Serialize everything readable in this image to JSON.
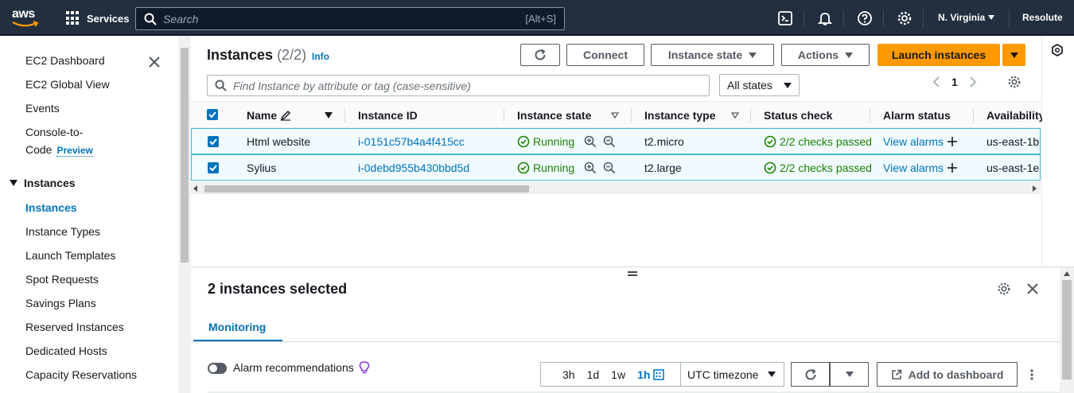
{
  "topnav": {
    "logo_text": "aws",
    "services_label": "Services",
    "search_placeholder": "Search",
    "search_shortcut": "[Alt+S]",
    "region_label": "N. Virginia",
    "account_label": "Resolute"
  },
  "sidebar": {
    "items": [
      {
        "label": "EC2 Dashboard"
      },
      {
        "label": "EC2 Global View"
      },
      {
        "label": "Events"
      },
      {
        "label": "Console-to-"
      },
      {
        "label": "Code"
      }
    ],
    "preview_badge": "Preview",
    "section_instances": "Instances",
    "instances_items": [
      {
        "label": "Instances",
        "active": true
      },
      {
        "label": "Instance Types"
      },
      {
        "label": "Launch Templates"
      },
      {
        "label": "Spot Requests"
      },
      {
        "label": "Savings Plans"
      },
      {
        "label": "Reserved Instances"
      },
      {
        "label": "Dedicated Hosts"
      },
      {
        "label": "Capacity Reservations"
      }
    ]
  },
  "main": {
    "title": "Instances",
    "count": "(2/2)",
    "info_label": "Info",
    "connect_label": "Connect",
    "instance_state_label": "Instance state",
    "actions_label": "Actions",
    "launch_label": "Launch instances",
    "filter_placeholder": "Find Instance by attribute or tag (case-sensitive)",
    "states_filter": "All states",
    "page_number": "1",
    "columns": [
      "Name",
      "Instance ID",
      "Instance state",
      "Instance type",
      "Status check",
      "Alarm status",
      "Availability"
    ],
    "rows": [
      {
        "name": "Html website",
        "id": "i-0151c57b4a4f415cc",
        "state": "Running",
        "type": "t2.micro",
        "status": "2/2 checks passed",
        "alarm": "View alarms",
        "az": "us-east-1b"
      },
      {
        "name": "Sylius",
        "id": "i-0debd955b430bbd5d",
        "state": "Running",
        "type": "t2.large",
        "status": "2/2 checks passed",
        "alarm": "View alarms",
        "az": "us-east-1e"
      }
    ]
  },
  "split": {
    "title": "2 instances selected",
    "tab_monitoring": "Monitoring",
    "alarm_recommendations": "Alarm recommendations",
    "ranges": [
      "3h",
      "1d",
      "1w",
      "1h"
    ],
    "timezone": "UTC timezone",
    "add_dashboard": "Add to dashboard"
  },
  "colors": {
    "nav_bg": "#232f3e",
    "accent_blue": "#0073bb",
    "primary_orange": "#ff9900",
    "running_green": "#1d8102"
  }
}
